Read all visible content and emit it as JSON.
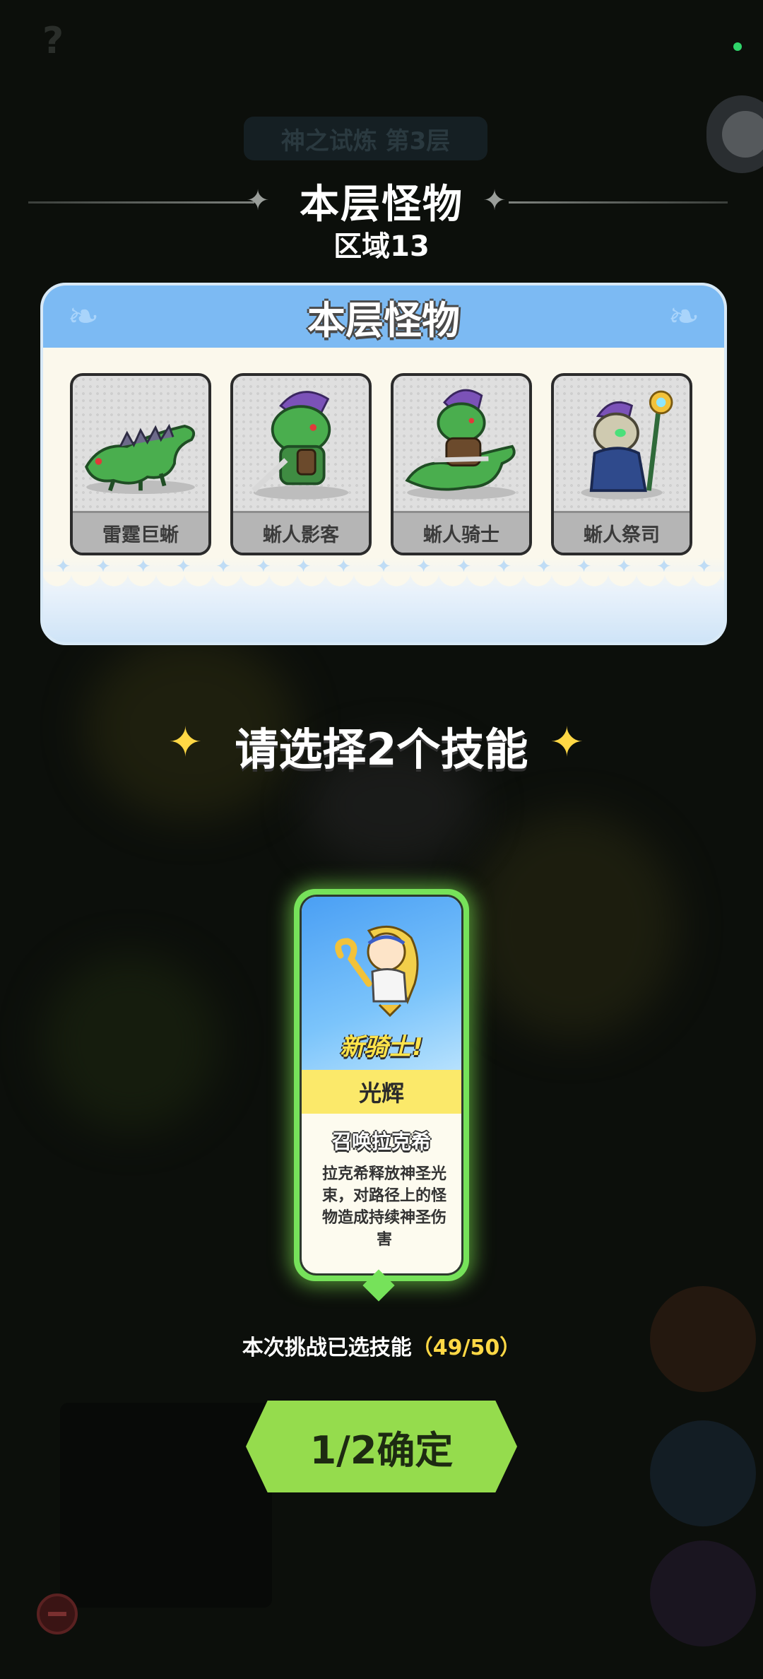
{
  "background": {
    "stage_label": "神之试炼 第3层"
  },
  "header": {
    "title": "本层怪物",
    "subtitle": "区域13"
  },
  "monster_panel": {
    "title": "本层怪物",
    "monsters": [
      {
        "name": "雷霆巨蜥",
        "icon": "thunder-lizard-icon"
      },
      {
        "name": "蜥人影客",
        "icon": "lizardman-shadow-icon"
      },
      {
        "name": "蜥人骑士",
        "icon": "lizardman-knight-icon"
      },
      {
        "name": "蜥人祭司",
        "icon": "lizardman-priest-icon"
      }
    ]
  },
  "skill_select": {
    "title": "请选择2个技能"
  },
  "skill_card": {
    "tag": "新骑士!",
    "name": "光辉",
    "subtitle": "召唤拉克希",
    "description": "拉克希释放神圣光束，对路径上的怪物造成持续神圣伤害"
  },
  "progress": {
    "label": "本次挑战已选技能",
    "count": "（49/50）"
  },
  "confirm_button": {
    "label": "1/2确定"
  },
  "colors": {
    "accent_green": "#95dc4d",
    "panel_blue": "#7cbaf3",
    "sparkle_yellow": "#ffd845"
  }
}
